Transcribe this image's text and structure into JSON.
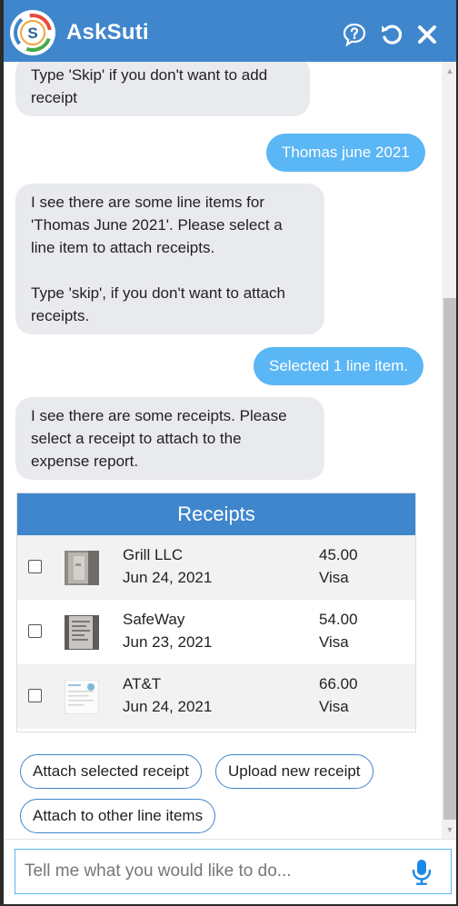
{
  "header": {
    "title": "AskSuti",
    "logo_letter": "S",
    "icons": [
      "help-icon",
      "reset-icon",
      "close-icon"
    ]
  },
  "messages": [
    {
      "from": "bot",
      "text": "Type 'Skip' if you don't want to add\nreceipt"
    },
    {
      "from": "user",
      "text": "Thomas june 2021"
    },
    {
      "from": "bot",
      "text": "I see there are some line items for\n'Thomas June 2021'. Please select a\nline item to attach receipts.\n\nType 'skip', if you don't want to attach\nreceipts."
    },
    {
      "from": "user",
      "text": "Selected 1 line item."
    },
    {
      "from": "bot",
      "text": "I see there are some receipts. Please\nselect a receipt to attach to the\nexpense report."
    }
  ],
  "receipts": {
    "title": "Receipts",
    "rows": [
      {
        "name": "Grill LLC",
        "date": "Jun 24, 2021",
        "amount": "45.00",
        "method": "Visa",
        "checked": false
      },
      {
        "name": "SafeWay",
        "date": "Jun 23, 2021",
        "amount": "54.00",
        "method": "Visa",
        "checked": false
      },
      {
        "name": "AT&T",
        "date": "Jun 24, 2021",
        "amount": "66.00",
        "method": "Visa",
        "checked": false
      }
    ]
  },
  "quick_replies": [
    "Attach selected receipt",
    "Upload new receipt",
    "Attach to other line items"
  ],
  "input": {
    "placeholder": "Tell me what you would like to do...",
    "value": ""
  },
  "colors": {
    "brand": "#3f86cc",
    "user_bubble": "#5ab6f5",
    "bot_bubble": "#e9eaee"
  }
}
